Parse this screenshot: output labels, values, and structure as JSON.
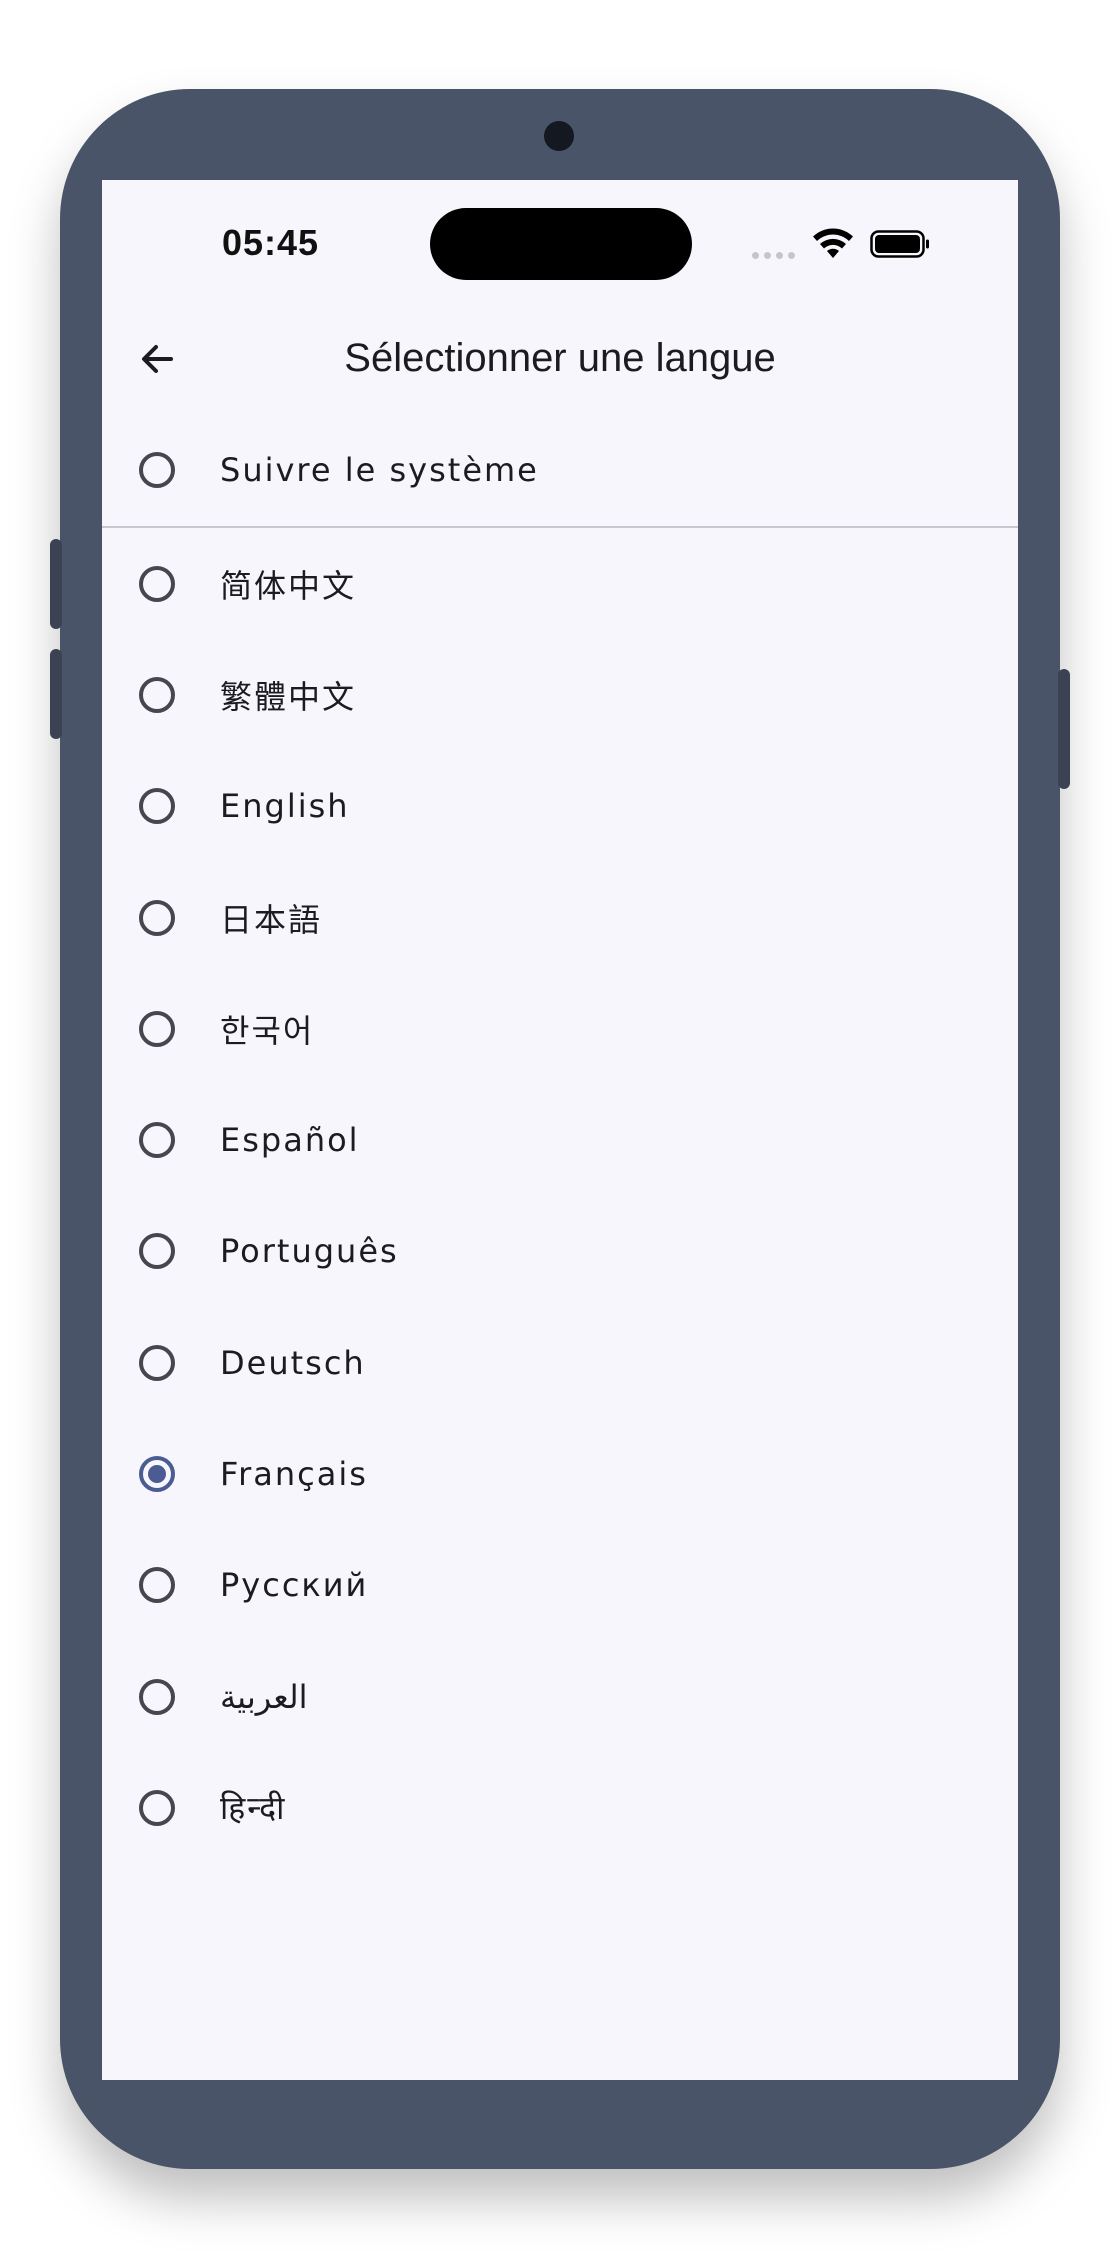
{
  "status_bar": {
    "time": "05:45"
  },
  "app_bar": {
    "title": "Sélectionner une langue",
    "back_icon": "arrow-left-icon"
  },
  "system_option": {
    "label": "Suivre le système",
    "selected": false
  },
  "languages": [
    {
      "label": "简体中文",
      "selected": false
    },
    {
      "label": "繁體中文",
      "selected": false
    },
    {
      "label": "English",
      "selected": false
    },
    {
      "label": "日本語",
      "selected": false
    },
    {
      "label": "한국어",
      "selected": false
    },
    {
      "label": "Español",
      "selected": false
    },
    {
      "label": "Português",
      "selected": false
    },
    {
      "label": "Deutsch",
      "selected": false
    },
    {
      "label": "Français",
      "selected": true
    },
    {
      "label": "Русский",
      "selected": false
    },
    {
      "label": "العربية",
      "selected": false
    },
    {
      "label": "हिन्दी",
      "selected": false
    }
  ],
  "colors": {
    "accent": "#4b5c92",
    "frame": "#4a5468",
    "screen_bg": "#f7f6fc"
  }
}
